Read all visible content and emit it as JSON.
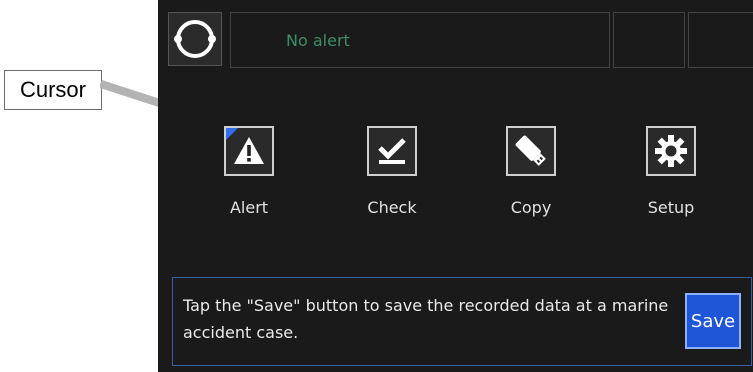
{
  "callout": {
    "label": "Cursor"
  },
  "header": {
    "alert_status": "No alert"
  },
  "menu": {
    "items": [
      {
        "label": "Alert",
        "icon": "warning-triangle-icon"
      },
      {
        "label": "Check",
        "icon": "checkmark-icon"
      },
      {
        "label": "Copy",
        "icon": "usb-drive-icon"
      },
      {
        "label": "Setup",
        "icon": "gear-icon"
      }
    ]
  },
  "message": {
    "text": "Tap the \"Save\" button to save the recorded data at a marine accident case.",
    "save_label": "Save"
  },
  "colors": {
    "screen_background": "#1a1a1a",
    "alert_text": "#3f8f63",
    "focus_marker": "#2f6ff0",
    "save_button": "#1f56d8",
    "panel_border": "#3a5fa8"
  }
}
